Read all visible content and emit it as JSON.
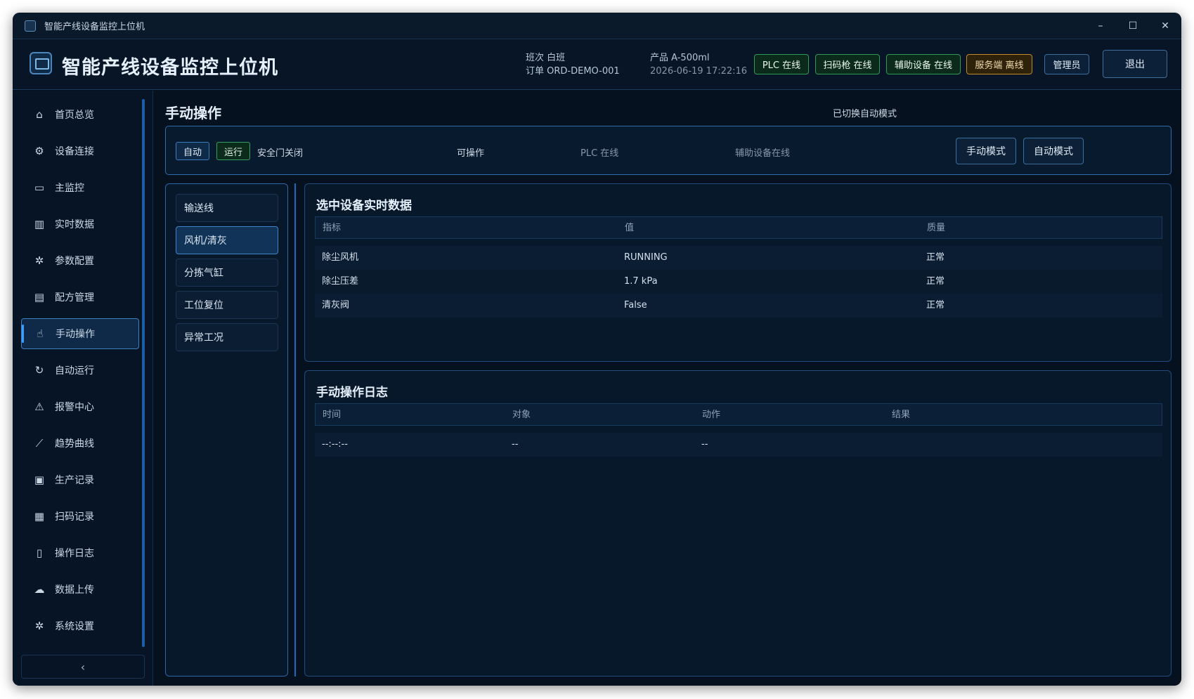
{
  "window": {
    "title": "智能产线设备监控上位机",
    "controls": [
      "–",
      "☐",
      "✕"
    ]
  },
  "header": {
    "app_title": "智能产线设备监控上位机",
    "shift_label": "班次 白班",
    "order_label": "订单 ORD-DEMO-001",
    "product_label": "产品 A-500ml",
    "datetime": "2026-06-19 17:22:16",
    "badges": [
      {
        "label": "PLC 在线",
        "status": "ok"
      },
      {
        "label": "扫码枪 在线",
        "status": "ok"
      },
      {
        "label": "辅助设备 在线",
        "status": "ok"
      },
      {
        "label": "服务端 离线",
        "status": "warn"
      }
    ],
    "user_label": "管理员",
    "logout_label": "退出"
  },
  "sidebar": {
    "items": [
      {
        "label": "首页总览",
        "icon": "home-icon"
      },
      {
        "label": "设备连接",
        "icon": "link-icon"
      },
      {
        "label": "主监控",
        "icon": "monitor-icon"
      },
      {
        "label": "实时数据",
        "icon": "bar-chart-icon"
      },
      {
        "label": "参数配置",
        "icon": "gear-icon"
      },
      {
        "label": "配方管理",
        "icon": "recipe-icon"
      },
      {
        "label": "手动操作",
        "icon": "hand-icon",
        "active": true
      },
      {
        "label": "自动运行",
        "icon": "refresh-icon"
      },
      {
        "label": "报警中心",
        "icon": "warning-icon"
      },
      {
        "label": "趋势曲线",
        "icon": "trend-icon"
      },
      {
        "label": "生产记录",
        "icon": "clipboard-icon"
      },
      {
        "label": "扫码记录",
        "icon": "barcode-icon"
      },
      {
        "label": "操作日志",
        "icon": "document-icon"
      },
      {
        "label": "数据上传",
        "icon": "upload-icon"
      },
      {
        "label": "系统设置",
        "icon": "settings-icon"
      }
    ],
    "collapse_glyph": "‹"
  },
  "main": {
    "page_title": "手动操作",
    "switch_message": "已切换自动模式",
    "status": {
      "mode_chip": "自动",
      "run_chip": "运行",
      "door_text": "安全门关闭",
      "operable_text": "可操作",
      "plc_text": "PLC 在线",
      "aux_text": "辅助设备在线",
      "manual_mode_button": "手动模式",
      "auto_mode_button": "自动模式"
    },
    "devices": [
      {
        "label": "输送线"
      },
      {
        "label": "风机/清灰",
        "active": true
      },
      {
        "label": "分拣气缸"
      },
      {
        "label": "工位复位"
      },
      {
        "label": "异常工况"
      }
    ],
    "realtime": {
      "title": "选中设备实时数据",
      "columns": [
        "指标",
        "值",
        "质量"
      ],
      "rows": [
        [
          "除尘风机",
          "RUNNING",
          "正常"
        ],
        [
          "除尘压差",
          "1.7 kPa",
          "正常"
        ],
        [
          "清灰阀",
          "False",
          "正常"
        ]
      ]
    },
    "log": {
      "title": "手动操作日志",
      "columns": [
        "时间",
        "对象",
        "动作",
        "结果"
      ],
      "rows": [
        [
          "--:--:--",
          "--",
          "--",
          ""
        ]
      ]
    }
  }
}
